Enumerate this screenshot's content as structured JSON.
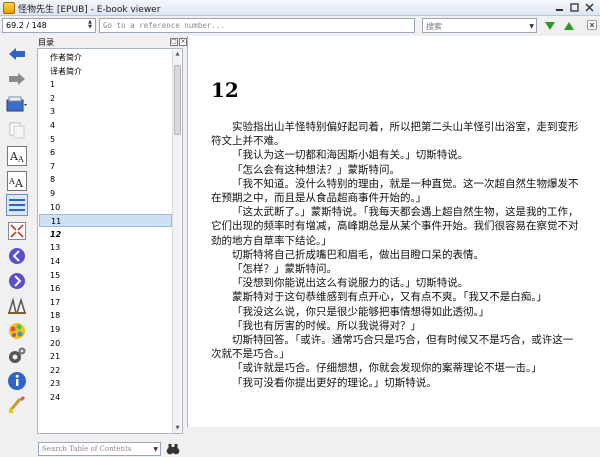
{
  "window": {
    "title": "怪物先生 [EPUB] - E-book viewer"
  },
  "toolbar": {
    "position": "69.2 / 148",
    "reference_placeholder": "Go to a reference number...",
    "search_placeholder": "搜索"
  },
  "toc": {
    "header": "目录",
    "items": [
      "作者简介",
      "译者简介",
      "1",
      "2",
      "3",
      "4",
      "5",
      "6",
      "7",
      "8",
      "9",
      "10",
      "11",
      "12",
      "13",
      "14",
      "15",
      "16",
      "17",
      "18",
      "19",
      "20",
      "21",
      "22",
      "23",
      "24"
    ],
    "selected_index": 12,
    "current_index": 13,
    "search_placeholder": "Search Table of Contents"
  },
  "reader": {
    "chapter_title": "12",
    "paragraphs": [
      "实验指出山羊怪特别偏好起司着，所以把第二头山羊怪引出浴室，走到变形符文上并不难。",
      "「我认为这一切都和海因斯小姐有关。」切斯特说。",
      "「怎么会有这种想法？」蒙斯特问。",
      "「我不知道。没什么特别的理由，就是一种直觉。这一次超自然生物爆发不在预期之中，而且是从食品超商事件开始的。」",
      "「这太武断了。」蒙斯特说。「我每天都会遇上超自然生物，这是我的工作，它们出现的频率时有增减，高峰期总是从某个事件开始。我们很容易在察觉不对劲的地方自草率下结论。」",
      "切斯特将自己折成嘴巴和眉毛，做出目瞪口呆的表情。",
      "「怎样？」蒙斯特问。",
      "「没想到你能说出这么有说服力的话。」切斯特说。",
      "蒙斯特对于这句恭维感到有点开心，又有点不爽。「我又不是白痴。」",
      "「我没这么说，你只是很少能够把事情想得如此透彻。」",
      "「我也有厉害的时候。所以我说得对？」",
      "切斯特回答。「或许。通常巧合只是巧合，但有时候又不是巧合，或许这一次就不是巧合。」",
      "「或许就是巧合。仔细想想，你就会发现你的案蒂理论不堪一击。」",
      "「我可没看你提出更好的理论。」切斯特说。"
    ]
  },
  "icons": {
    "back": "back-arrow-icon",
    "forward": "forward-arrow-icon",
    "open": "open-book-icon",
    "copy": "copy-icon",
    "font_larger": "font-larger-icon",
    "font_smaller": "font-smaller-icon",
    "toc": "toc-icon",
    "fullscreen": "fullscreen-icon",
    "prev": "previous-icon",
    "next": "next-icon",
    "bookmark": "bookmark-icon",
    "theme": "theme-icon",
    "preferences": "preferences-icon",
    "about": "info-icon",
    "print": "print-icon"
  },
  "colors": {
    "accent_blue": "#2e63c8",
    "nav_green": "#2b9a2b",
    "selection": "#cde0f4"
  }
}
